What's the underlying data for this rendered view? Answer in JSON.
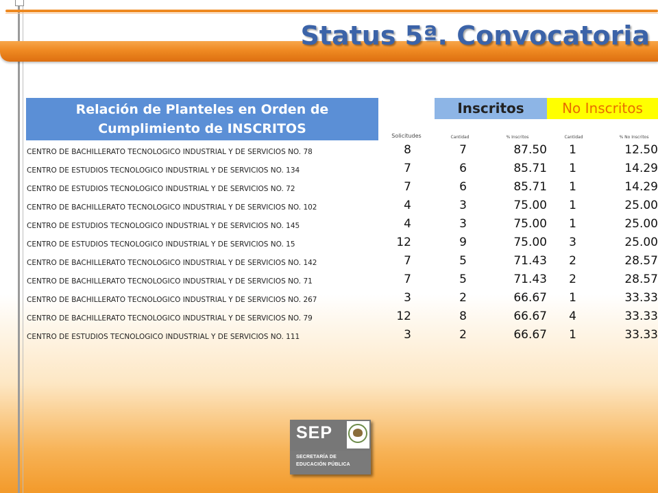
{
  "title": "Status 5ª. Convocatoria",
  "table": {
    "heading_line1": "Relación de Planteles en Orden de",
    "heading_line2": "Cumplimiento de INSCRITOS",
    "group_inscritos": "Inscritos",
    "group_no_inscritos": "No Inscritos",
    "col_solicitudes": "Solicitudes",
    "col_cantidad1": "Cantidad",
    "col_pct_inscritos": "% Inscritos",
    "col_cantidad2": "Cantidad",
    "col_pct_no_inscritos": "% No Inscritos",
    "rows": [
      {
        "name": "CENTRO DE BACHILLERATO TECNOLOGICO INDUSTRIAL Y DE SERVICIOS NO. 78",
        "sol": "8",
        "c1": "7",
        "p1": "87.50",
        "c2": "1",
        "p2": "12.50"
      },
      {
        "name": "CENTRO DE ESTUDIOS TECNOLOGICO INDUSTRIAL Y DE SERVICIOS NO. 134",
        "sol": "7",
        "c1": "6",
        "p1": "85.71",
        "c2": "1",
        "p2": "14.29"
      },
      {
        "name": "CENTRO DE ESTUDIOS TECNOLOGICO INDUSTRIAL Y DE SERVICIOS NO. 72",
        "sol": "7",
        "c1": "6",
        "p1": "85.71",
        "c2": "1",
        "p2": "14.29"
      },
      {
        "name": "CENTRO DE BACHILLERATO TECNOLOGICO INDUSTRIAL Y DE SERVICIOS NO. 102",
        "sol": "4",
        "c1": "3",
        "p1": "75.00",
        "c2": "1",
        "p2": "25.00"
      },
      {
        "name": "CENTRO DE ESTUDIOS TECNOLOGICO INDUSTRIAL Y DE SERVICIOS NO. 145",
        "sol": "4",
        "c1": "3",
        "p1": "75.00",
        "c2": "1",
        "p2": "25.00"
      },
      {
        "name": "CENTRO DE ESTUDIOS TECNOLOGICO INDUSTRIAL Y DE SERVICIOS NO. 15",
        "sol": "12",
        "c1": "9",
        "p1": "75.00",
        "c2": "3",
        "p2": "25.00"
      },
      {
        "name": "CENTRO DE BACHILLERATO TECNOLOGICO INDUSTRIAL Y DE SERVICIOS NO. 142",
        "sol": "7",
        "c1": "5",
        "p1": "71.43",
        "c2": "2",
        "p2": "28.57"
      },
      {
        "name": "CENTRO DE BACHILLERATO TECNOLOGICO INDUSTRIAL Y DE SERVICIOS NO. 71",
        "sol": "7",
        "c1": "5",
        "p1": "71.43",
        "c2": "2",
        "p2": "28.57"
      },
      {
        "name": "CENTRO DE BACHILLERATO TECNOLOGICO INDUSTRIAL Y DE SERVICIOS NO. 267",
        "sol": "3",
        "c1": "2",
        "p1": "66.67",
        "c2": "1",
        "p2": "33.33"
      },
      {
        "name": "CENTRO DE BACHILLERATO TECNOLOGICO INDUSTRIAL Y DE SERVICIOS NO. 79",
        "sol": "12",
        "c1": "8",
        "p1": "66.67",
        "c2": "4",
        "p2": "33.33"
      },
      {
        "name": "CENTRO DE ESTUDIOS TECNOLOGICO INDUSTRIAL Y DE SERVICIOS NO. 111",
        "sol": "3",
        "c1": "2",
        "p1": "66.67",
        "c2": "1",
        "p2": "33.33"
      }
    ]
  },
  "logo": {
    "acronym": "SEP",
    "line1": "SECRETARÍA DE",
    "line2": "EDUCACIÓN PÚBLICA"
  },
  "colors": {
    "title_blue": "#3b63a8",
    "header_blue": "#5b8fd6",
    "inscritos_blue": "#8db5e6",
    "no_inscritos_yellow": "#ffff00",
    "no_inscritos_text": "#e86d00",
    "band_orange": "#ef8a22"
  }
}
